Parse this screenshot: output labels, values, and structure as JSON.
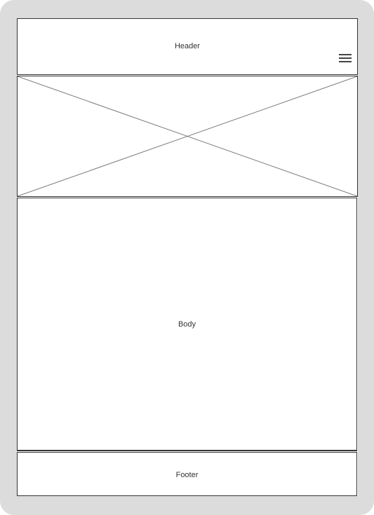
{
  "header": {
    "title": "Header",
    "menu_icon": "hamburger-menu-icon"
  },
  "hero": {
    "image_placeholder": "image-placeholder-icon"
  },
  "body": {
    "label": "Body"
  },
  "footer": {
    "label": "Footer"
  },
  "colors": {
    "frame": "#dcdcdc",
    "border": "#333333",
    "surface": "#ffffff"
  }
}
